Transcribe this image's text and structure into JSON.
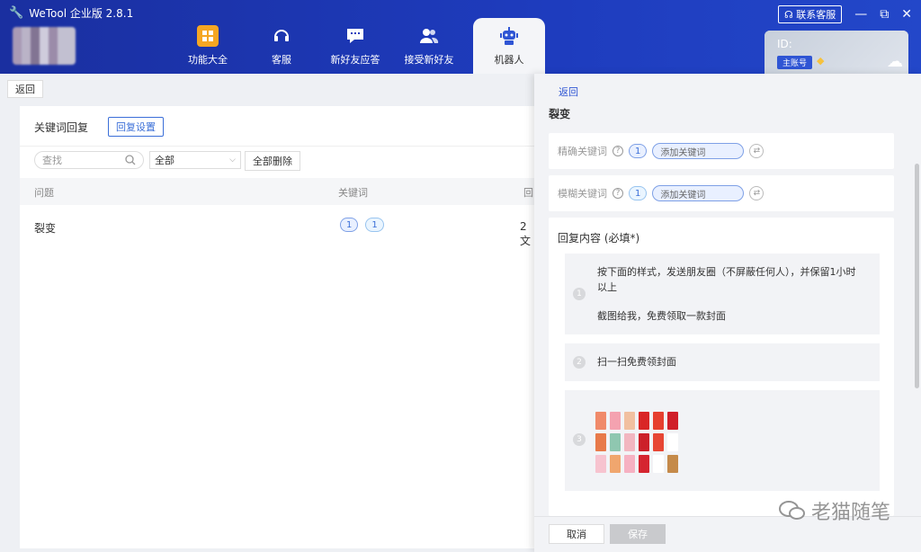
{
  "app": {
    "title": "WeTool 企业版 2.8.1"
  },
  "nav": [
    {
      "label": "功能大全",
      "icon": "grid-icon"
    },
    {
      "label": "客服",
      "icon": "headset-icon"
    },
    {
      "label": "新好友应答",
      "icon": "chat-icon"
    },
    {
      "label": "接受新好友",
      "icon": "users-icon"
    },
    {
      "label": "机器人",
      "icon": "robot-icon"
    }
  ],
  "window": {
    "contact_label": "联系客服"
  },
  "account": {
    "id_label": "ID:",
    "badge": "主账号"
  },
  "left": {
    "back_label": "返回",
    "title": "关键词回复",
    "reply_settings_label": "回复设置",
    "search_placeholder": "查找",
    "filter_value": "全部",
    "delete_all_label": "全部删除",
    "columns": [
      "问题",
      "关键词",
      "回"
    ],
    "rows": [
      {
        "question": "裂变",
        "kw1": "1",
        "kw2": "1",
        "reply": "2文"
      }
    ]
  },
  "drawer": {
    "back_label": "返回",
    "title": "裂变",
    "exact_label": "精确关键词",
    "exact_count": "1",
    "fuzzy_label": "模糊关键词",
    "fuzzy_count": "1",
    "add_keyword_placeholder": "添加关键词",
    "content_title": "回复内容 (必填*)",
    "items": [
      {
        "num": "1",
        "line1": "按下面的样式，发送朋友圈（不屏蔽任何人），并保留1小时",
        "line2": "以上",
        "line3": "截图给我，免费领取一款封面"
      },
      {
        "num": "2",
        "text": "扫一扫免费领封面"
      },
      {
        "num": "3"
      }
    ],
    "cancel_label": "取消",
    "save_label": "保存"
  },
  "watermark": {
    "text": "老猫随笔"
  },
  "colors": {
    "header": "#1e3cbe",
    "accent": "#2f55d4",
    "badge": "#f5a623"
  }
}
